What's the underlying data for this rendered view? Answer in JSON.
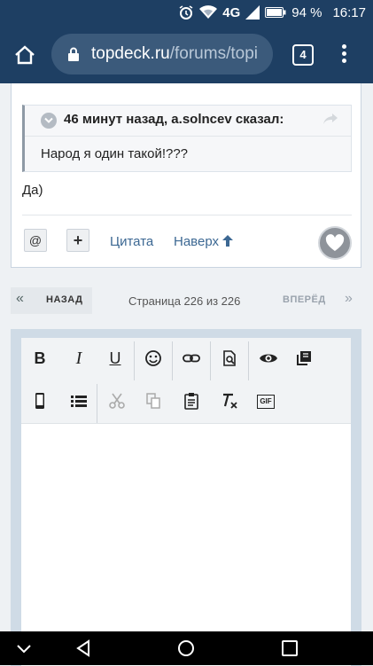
{
  "status": {
    "battery_percent": "94 %",
    "time": "16:17",
    "network": "4G"
  },
  "browser": {
    "url_host": "topdeck.ru",
    "url_path": "/forums/topi",
    "tab_count": "4"
  },
  "post": {
    "quote_header": "46 минут назад, a.solncev сказал:",
    "quote_text": "Народ я один такой!???",
    "reply_text": "Да)",
    "mention_button": "@",
    "multiquote_button": "+",
    "quote_link": "Цитата",
    "to_top_link": "Наверх"
  },
  "pagination": {
    "prev_arrows": "«",
    "prev_label": "НАЗАД",
    "page_info": "Страница 226 из 226",
    "next_label": "ВПЕРЁД",
    "next_arrows": "»"
  },
  "editor": {
    "toolbar_row1": [
      {
        "name": "bold",
        "label": "B"
      },
      {
        "name": "italic",
        "label": "I"
      },
      {
        "name": "underline",
        "label": "U"
      },
      {
        "name": "emoji",
        "label": ""
      },
      {
        "name": "link",
        "label": ""
      },
      {
        "name": "preview",
        "label": ""
      },
      {
        "name": "spoiler",
        "label": ""
      },
      {
        "name": "copy-source",
        "label": ""
      }
    ],
    "toolbar_row2": [
      {
        "name": "mobile",
        "label": ""
      },
      {
        "name": "list",
        "label": ""
      },
      {
        "name": "cut",
        "label": ""
      },
      {
        "name": "copy",
        "label": ""
      },
      {
        "name": "paste",
        "label": ""
      },
      {
        "name": "clear-format",
        "label": ""
      },
      {
        "name": "gif",
        "label": "GIF"
      }
    ]
  },
  "colors": {
    "header_bg": "#1e3f63",
    "link": "#3c6893",
    "accent_bg": "#cfdbe6"
  }
}
